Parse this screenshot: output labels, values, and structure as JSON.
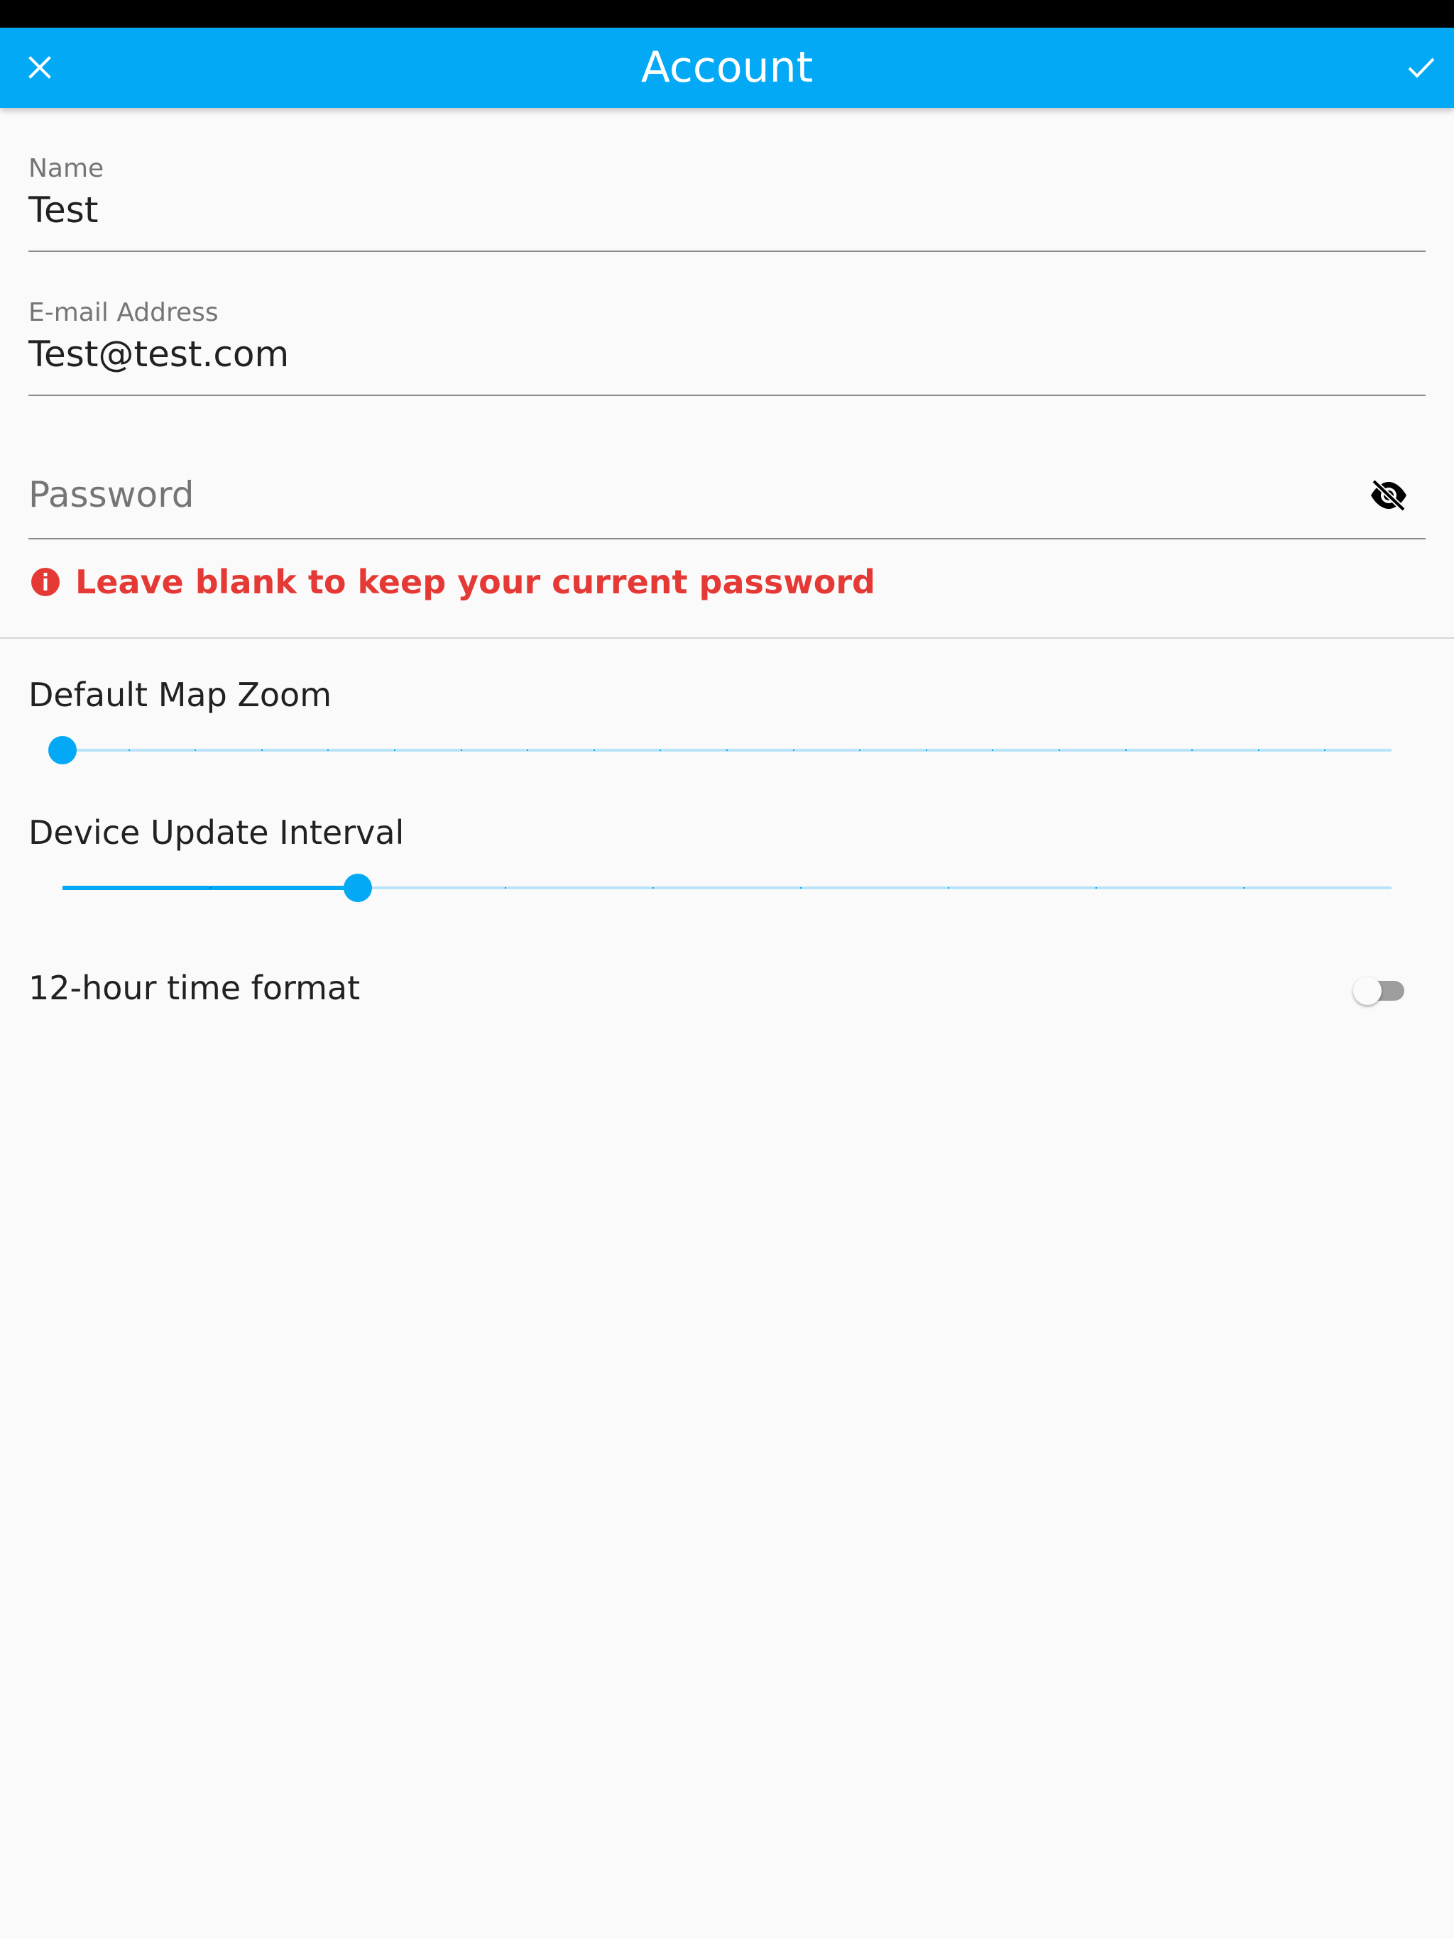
{
  "app_bar": {
    "title": "Account",
    "close_icon": "close-icon",
    "confirm_icon": "check-icon",
    "color": "#03a9f4"
  },
  "form": {
    "name": {
      "label": "Name",
      "value": "Test"
    },
    "email": {
      "label": "E-mail Address",
      "value": "Test@test.com"
    },
    "password": {
      "placeholder": "Password",
      "value": "",
      "visibility_icon": "visibility-off-icon",
      "helper_icon": "error-icon",
      "helper_text": "Leave blank to keep your current password",
      "helper_color": "#e53935"
    }
  },
  "settings": {
    "map_zoom": {
      "label": "Default Map Zoom",
      "steps": 21,
      "value_index": 0
    },
    "update_interval": {
      "label": "Device Update Interval",
      "steps": 10,
      "value_index": 2
    },
    "time_format": {
      "label": "12-hour time format",
      "enabled": false
    }
  }
}
